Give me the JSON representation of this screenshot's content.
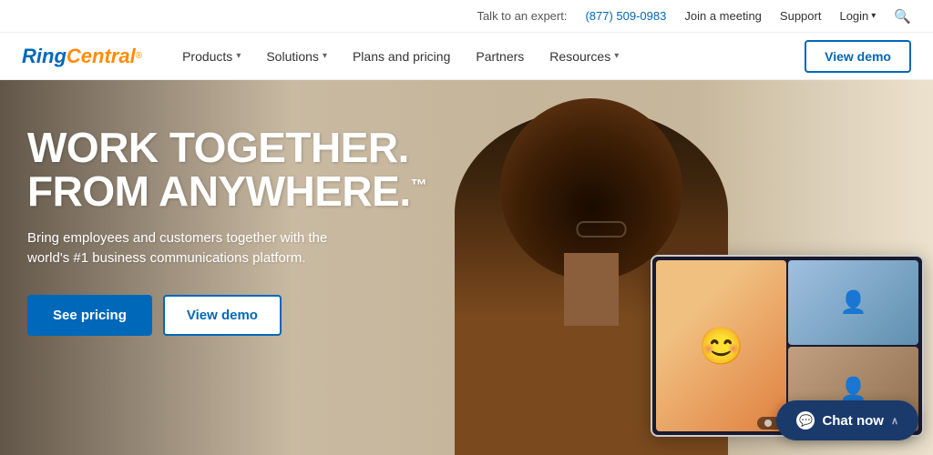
{
  "brand": {
    "logo_ring": "Ring",
    "logo_central": "Central",
    "logo_tm": "®"
  },
  "topbar": {
    "talk_label": "Talk to an expert:",
    "phone": "(877) 509-0983",
    "join_meeting": "Join a meeting",
    "support": "Support",
    "login": "Login",
    "login_chevron": "▾"
  },
  "nav": {
    "items": [
      {
        "label": "Products",
        "has_dropdown": true
      },
      {
        "label": "Solutions",
        "has_dropdown": true
      },
      {
        "label": "Plans and pricing",
        "has_dropdown": false
      },
      {
        "label": "Partners",
        "has_dropdown": false
      },
      {
        "label": "Resources",
        "has_dropdown": true
      }
    ],
    "view_demo": "View demo"
  },
  "hero": {
    "headline_line1": "WORK TOGETHER.",
    "headline_line2": "FROM ANYWHERE.",
    "trademark": "™",
    "subheadline": "Bring employees and customers together with the world's #1 business communications platform.",
    "btn_primary": "See pricing",
    "btn_secondary": "View demo"
  },
  "chat": {
    "label": "Chat now",
    "chevron": "∧"
  }
}
